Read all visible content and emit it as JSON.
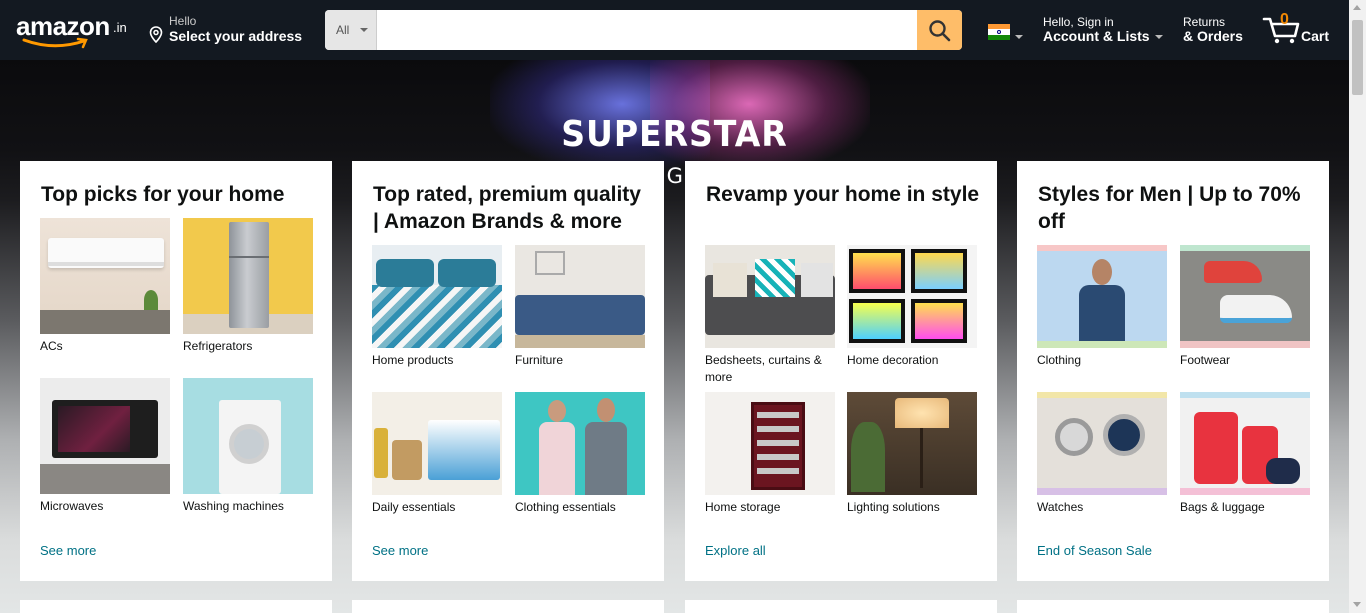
{
  "header": {
    "logo_text": "amazon",
    "logo_suffix": ".in",
    "address_line1": "Hello",
    "address_line2": "Select your address",
    "search_category": "All",
    "search_value": "",
    "account_line1": "Hello, Sign in",
    "account_line2": "Account & Lists",
    "orders_line1": "Returns",
    "orders_line2": "& Orders",
    "cart_count": "0",
    "cart_label": "Cart"
  },
  "hero": {
    "title": "SUPERSTAR",
    "subtitle": "COMING SOON"
  },
  "cards": [
    {
      "title": "Top picks for your home",
      "tiles": [
        {
          "label": "ACs"
        },
        {
          "label": "Refrigerators"
        },
        {
          "label": "Microwaves"
        },
        {
          "label": "Washing machines"
        }
      ],
      "link": "See more"
    },
    {
      "title": "Top rated, premium quality | Amazon Brands & more",
      "tiles": [
        {
          "label": "Home products"
        },
        {
          "label": "Furniture"
        },
        {
          "label": "Daily essentials"
        },
        {
          "label": "Clothing essentials"
        }
      ],
      "link": "See more"
    },
    {
      "title": "Revamp your home in style",
      "tiles": [
        {
          "label": "Bedsheets, curtains & more"
        },
        {
          "label": "Home decoration"
        },
        {
          "label": "Home storage"
        },
        {
          "label": "Lighting solutions"
        }
      ],
      "link": "Explore all"
    },
    {
      "title": "Styles for Men | Up to 70% off",
      "tiles": [
        {
          "label": "Clothing"
        },
        {
          "label": "Footwear"
        },
        {
          "label": "Watches"
        },
        {
          "label": "Bags & luggage"
        }
      ],
      "link": "End of Season Sale"
    }
  ],
  "colors": {
    "nav_bg": "#131921",
    "search_button": "#febd69",
    "link": "#007185",
    "cart_count": "#f08804"
  }
}
